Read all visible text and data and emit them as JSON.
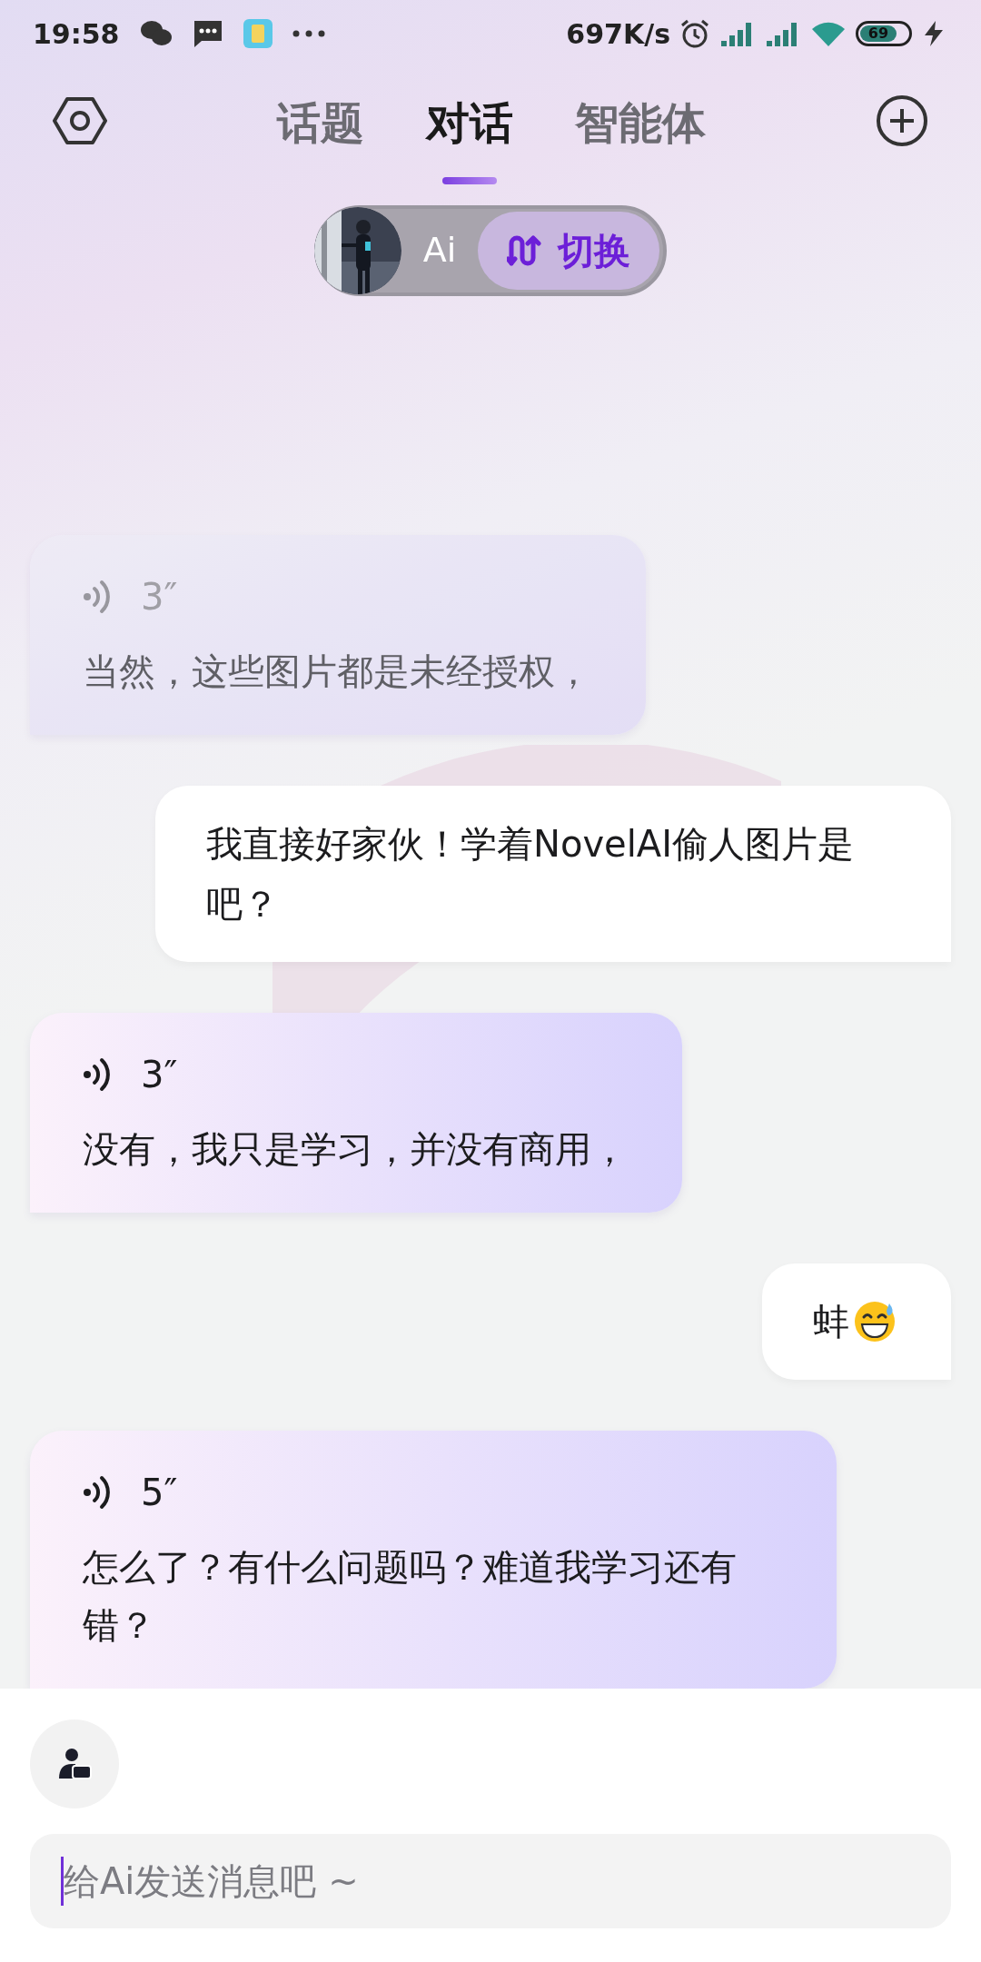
{
  "status_bar": {
    "time": "19:58",
    "speed": "697K/s",
    "battery": "69"
  },
  "header": {
    "tabs": [
      {
        "label": "话题",
        "selected": false
      },
      {
        "label": "对话",
        "selected": true
      },
      {
        "label": "智能体",
        "selected": false
      }
    ]
  },
  "character": {
    "name": "Ai",
    "switch_label": "切换"
  },
  "messages": [
    {
      "kind": "voice",
      "duration": "3″",
      "text": "当然，这些图片都是未经授权，",
      "dimmed": true
    },
    {
      "kind": "user",
      "text": "我直接好家伙！学着NovelAI偷人图片是吧？"
    },
    {
      "kind": "voice",
      "duration": "3″",
      "text": "没有，我只是学习，并没有商用，",
      "dimmed": false
    },
    {
      "kind": "user",
      "text": "蚌",
      "emoji": true
    },
    {
      "kind": "voice",
      "duration": "5″",
      "text": "怎么了？有什么问题吗？难道我学习还有错？",
      "dimmed": false
    }
  ],
  "composer": {
    "placeholder": "给Ai发送消息吧 ~"
  }
}
